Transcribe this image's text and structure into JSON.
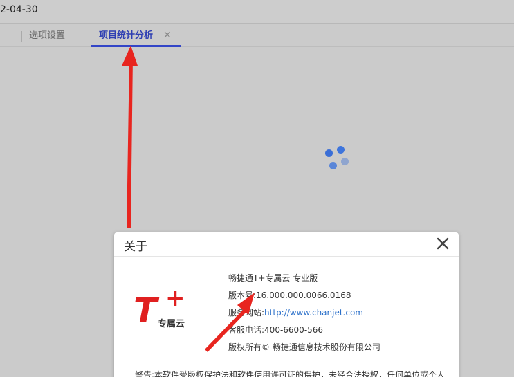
{
  "header": {
    "date_fragment": "2-04-30"
  },
  "tabs": [
    {
      "label": "选项设置"
    },
    {
      "label": "项目统计分析",
      "close": "✕"
    }
  ],
  "dialog": {
    "title": "关于",
    "close_icon": "close-icon",
    "logo": {
      "mark": "T",
      "plus": "+",
      "sub": "专属云"
    },
    "info": {
      "product": "畅捷通T+专属云 专业版",
      "version_label": "版本号:",
      "version": "16.000.000.0066.0168",
      "website_label": "服务网站:",
      "website": "http://www.chanjet.com",
      "phone_label": "客服电话:",
      "phone": "400-6600-566",
      "copyright": "版权所有© 畅捷通信息技术股份有限公司"
    },
    "warning": "警告:本软件受版权保护法和软件使用许可证的保护，未经合法授权，任何单位或个人"
  },
  "colors": {
    "accent": "#3345c7",
    "arrow": "#e8251f",
    "logo_red": "#e02020",
    "link": "#2a6fc9"
  },
  "icons": [
    "loading-spinner-icon",
    "close-icon",
    "arrow-annotation"
  ]
}
